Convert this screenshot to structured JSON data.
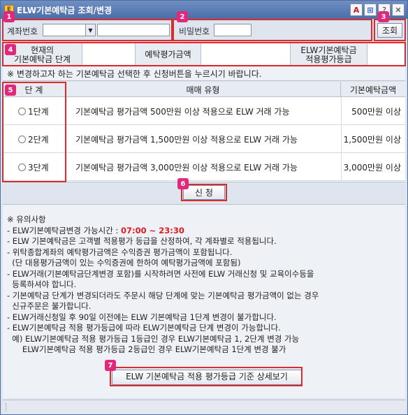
{
  "window": {
    "title": "ELW기본예탁금 조회/변경",
    "title_buttons": [
      "A",
      "⊞",
      "?",
      "✕"
    ]
  },
  "search": {
    "account_label": "계좌번호",
    "account_value": "",
    "account_name_value": "",
    "password_label": "비밀번호",
    "password_value": "",
    "query_button": "조회"
  },
  "info": {
    "current_deposit_label_1": "현재의",
    "current_deposit_label_2": "기본예탁금 단계",
    "current_deposit_value": "",
    "deposit_eval_label": "예탁평가금액",
    "deposit_eval_value": "",
    "applied_grade_label_1": "ELW기본예탁금",
    "applied_grade_label_2": "적용평가등급",
    "applied_grade_value": ""
  },
  "notice": "※ 변경하고자 하는 기본예탁금 선택한 후 신청버튼을 누르시기 바랍니다.",
  "table": {
    "headers": [
      "단 계",
      "매매 유형",
      "기본예탁금액"
    ],
    "rows": [
      {
        "level": "1단계",
        "description": "기본예탁금 평가금액 500만원 이상 적용으로 ELW 거래 가능",
        "amount": "500만원 이상"
      },
      {
        "level": "2단계",
        "description": "기본예탁금 평가금액 1,500만원 이상 적용으로 ELW 거래 가능",
        "amount": "1,500만원 이상"
      },
      {
        "level": "3단계",
        "description": "기본예탁금 평가금액 3,000만원 이상 적용으로 ELW 거래 가능",
        "amount": "3,000만원 이상"
      }
    ]
  },
  "apply_button": "신 청",
  "notes": {
    "title": "※ 유의사항",
    "time_prefix": "- ELW기본예탁금변경 가능시간 : ",
    "time_value": "07:00 ~ 23:30",
    "lines": [
      "- ELW 기본예탁금은 고객별 적용평가 등급을 산정하여, 각 계좌별로 적용됩니다.",
      "- 위탁종합계좌의 예탁평가금액은 수익증권 평가금액이 포함됩니다.",
      "  (단 대용평가금액이 있는 수익증권에 한하여 예탁평가금액에 포함됨)",
      "- ELW거래(기본예탁금단계변경 포함)를 시작하려면 사전에 ELW 거래신청 및 교육이수등을",
      "  등록하셔야 합니다.",
      "- 기본예탁금 단계가 변경되더라도 주문시 해당 단계에 맞는 기본예탁금 평가금액이 없는 경우",
      "  신규주문은 불가합니다.",
      "- ELW거래신청일 후 90일 이전에는 ELW 기본예탁금 1단계 변경이 불가합니다.",
      "- ELW기본예탁금 적용 평가등급에 따라 ELW기본예탁금 단계 변경이 가능합니다.",
      "  예) ELW기본예탁금 적용 평가등급 1등급인 경우 ELW기본예탁금 1, 2단계 변경 가능",
      "      ELW기본예탁금 적용 평가등급 2등급인 경우 ELW기본예탁금 1단계 변경 불가"
    ],
    "detail_button": "ELW 기본예탁금 적용 평가등급 기준 상세보기"
  },
  "badges": [
    "1",
    "2",
    "3",
    "4",
    "5",
    "6",
    "7"
  ],
  "colors": {
    "title_bar": "#4b6ea8",
    "highlight_box": "#e02a2a",
    "badge": "#e0287c",
    "time_text": "#e01b1b"
  }
}
